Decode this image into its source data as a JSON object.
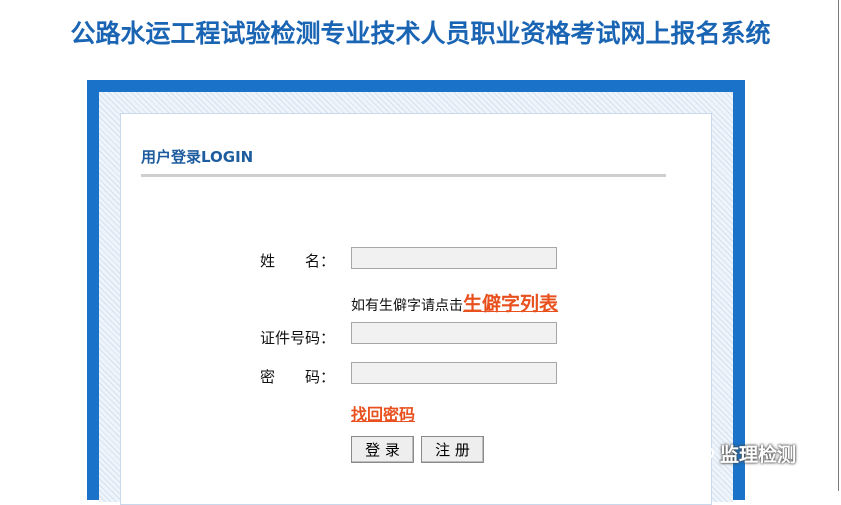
{
  "header": {
    "title": "公路水运工程试验检测专业技术人员职业资格考试网上报名系统"
  },
  "login": {
    "heading": "用户登录LOGIN",
    "name_label": "姓　　名：",
    "name_value": "",
    "rare_hint": "如有生僻字请点击",
    "rare_link": "生僻字列表",
    "id_label": "证件号码：",
    "id_value": "",
    "password_label": "密　　码：",
    "password_value": "",
    "forgot_link": "找回密码",
    "login_button": "登 录",
    "register_button": "注 册"
  },
  "watermark": {
    "text": "监理检测"
  },
  "colors": {
    "title": "#1a64b4",
    "frame": "#1a73c8",
    "link": "#e8501e"
  }
}
